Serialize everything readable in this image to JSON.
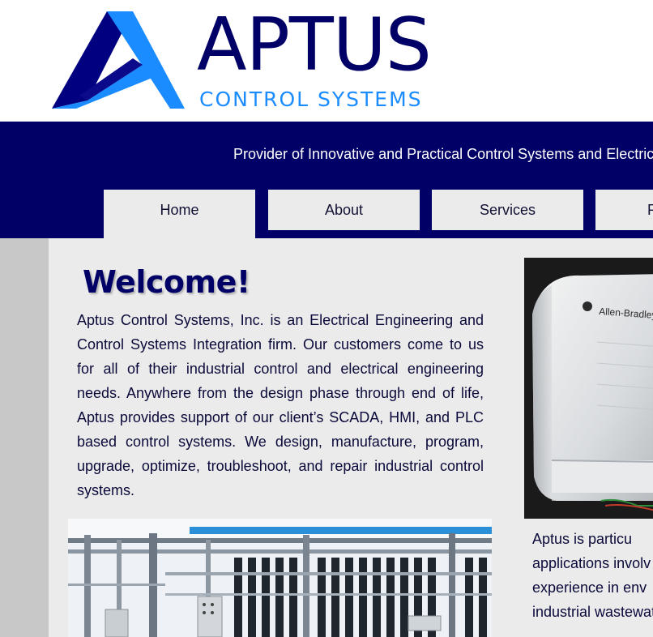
{
  "header": {
    "brand_name": "APTUS",
    "brand_sub": "CONTROL SYSTEMS",
    "logo_icon": "aptus-a-logo-icon",
    "colors": {
      "navy": "#000066",
      "blue": "#1a8cff",
      "royal": "#000099"
    }
  },
  "band": {
    "tagline": "Provider of Innovative and Practical Control Systems and Electrical",
    "color": "#000066"
  },
  "nav": {
    "tabs": [
      {
        "label": "Home",
        "active": true
      },
      {
        "label": "About",
        "active": false
      },
      {
        "label": "Services",
        "active": false
      },
      {
        "label": "P",
        "active": false
      }
    ]
  },
  "main": {
    "welcome": "Welcome!",
    "intro": "Aptus Control Systems, Inc. is an Electrical Engineering and Control Systems Integration firm. Our customers come to us for all of their industrial control and electrical engineering needs. Anywhere from the design phase through end of life, Aptus provides support of our client’s SCADA, HMI, and PLC based control systems. We design, manufacture, program, upgrade, optimize, troubleshoot, and repair industrial control systems.",
    "device_photo": {
      "brand_label": "Allen-Bradley"
    },
    "right_text_lines": [
      "Aptus    is    particu",
      "applications    involv",
      "experience    in    env",
      "industrial wastewate"
    ]
  }
}
